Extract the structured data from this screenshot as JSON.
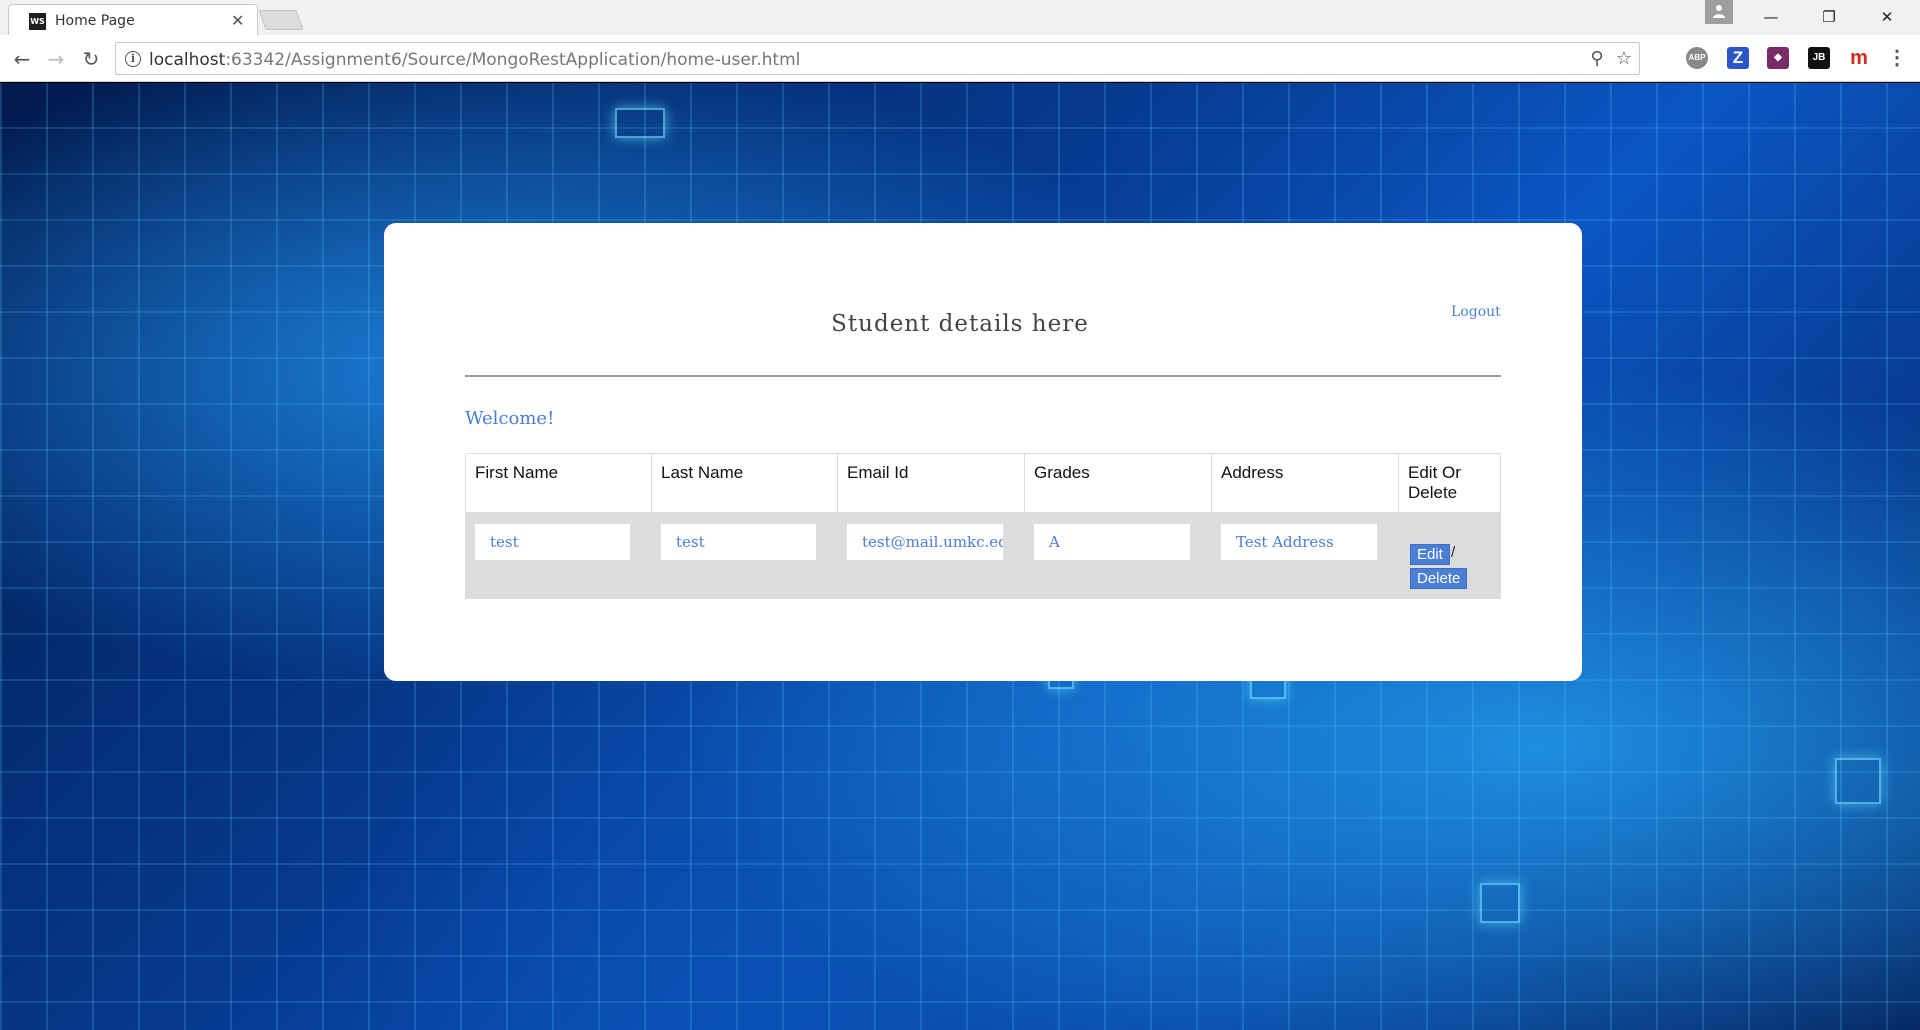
{
  "browser": {
    "tab_title": "Home Page",
    "tab_favicon": "WS",
    "url_host": "localhost",
    "url_path": ":63342/Assignment6/Source/MongoRestApplication/home-user.html",
    "extensions": [
      "ABP",
      "Z",
      "JB",
      "m"
    ]
  },
  "page": {
    "heading": "Student details here",
    "logout": "Logout",
    "welcome": "Welcome!"
  },
  "table": {
    "headers": [
      "First Name",
      "Last Name",
      "Email Id",
      "Grades",
      "Address",
      "Edit Or Delete"
    ],
    "row": {
      "first_name": "test",
      "last_name": "test",
      "email": "test@mail.umkc.edu",
      "grade": "A",
      "address": "Test Address"
    },
    "edit_label": "Edit",
    "separator": "/",
    "delete_label": "Delete"
  },
  "colors": {
    "accent": "#4a7fd6",
    "row_background": "#dcdcdc"
  }
}
